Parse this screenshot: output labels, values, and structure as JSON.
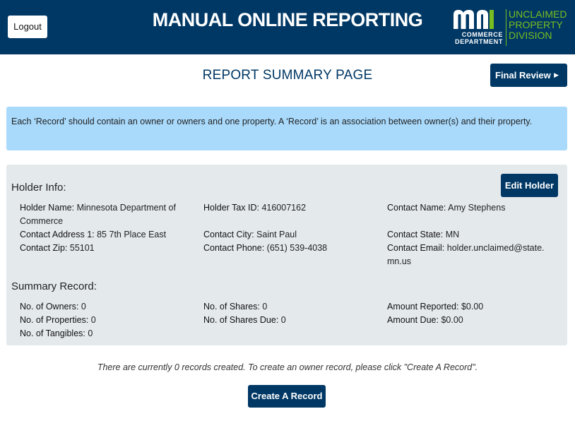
{
  "header": {
    "logout_label": "Logout",
    "title": "MANUAL ONLINE REPORTING",
    "logo": {
      "mark": "mn",
      "dept_line1": "COMMERCE",
      "dept_line2": "DEPARTMENT",
      "division_line1": "UNCLAIMED",
      "division_line2": "PROPERTY",
      "division_line3": "DIVISION"
    }
  },
  "page": {
    "title": "REPORT SUMMARY PAGE",
    "final_review_label": "Final Review",
    "info_text": "Each ‘Record’ should contain an owner or owners and one property. A ‘Record’ is an association between owner(s) and their property."
  },
  "holder": {
    "section_title": "Holder Info:",
    "edit_label": "Edit Holder",
    "fields": {
      "holder_name": {
        "label": "Holder Name:",
        "value": "Minnesota Department of Commerce"
      },
      "holder_tax_id": {
        "label": "Holder Tax ID:",
        "value": "416007162"
      },
      "contact_name": {
        "label": "Contact Name:",
        "value": "Amy Stephens"
      },
      "contact_address": {
        "label": "Contact Address 1:",
        "value": "85 7th Place East"
      },
      "contact_city": {
        "label": "Contact City:",
        "value": "Saint Paul"
      },
      "contact_state": {
        "label": "Contact State:",
        "value": "MN"
      },
      "contact_zip": {
        "label": "Contact Zip:",
        "value": "55101"
      },
      "contact_phone": {
        "label": "Contact Phone:",
        "value": "(651) 539-4038"
      },
      "contact_email": {
        "label": "Contact Email:",
        "value": "holder.unclaimed@state.mn.us"
      }
    }
  },
  "summary": {
    "section_title": "Summary Record:",
    "fields": {
      "owners": {
        "label": "No. of Owners:",
        "value": "0"
      },
      "properties": {
        "label": "No. of Properties:",
        "value": "0"
      },
      "tangibles": {
        "label": "No. of Tangibles:",
        "value": "0"
      },
      "shares": {
        "label": "No. of Shares:",
        "value": "0"
      },
      "shares_due": {
        "label": "No. of Shares Due:",
        "value": "0"
      },
      "amount_reported": {
        "label": "Amount Reported:",
        "value": "$0.00"
      },
      "amount_due": {
        "label": "Amount Due:",
        "value": "$0.00"
      }
    }
  },
  "records": {
    "empty_message": "There are currently 0 records created. To create an owner record, please click \"Create A Record\".",
    "create_label": "Create A Record"
  },
  "colors": {
    "brand_navy": "#003865",
    "brand_green": "#78be20",
    "info_blue": "#a9dafc",
    "panel_gray": "#e4e9ec"
  }
}
